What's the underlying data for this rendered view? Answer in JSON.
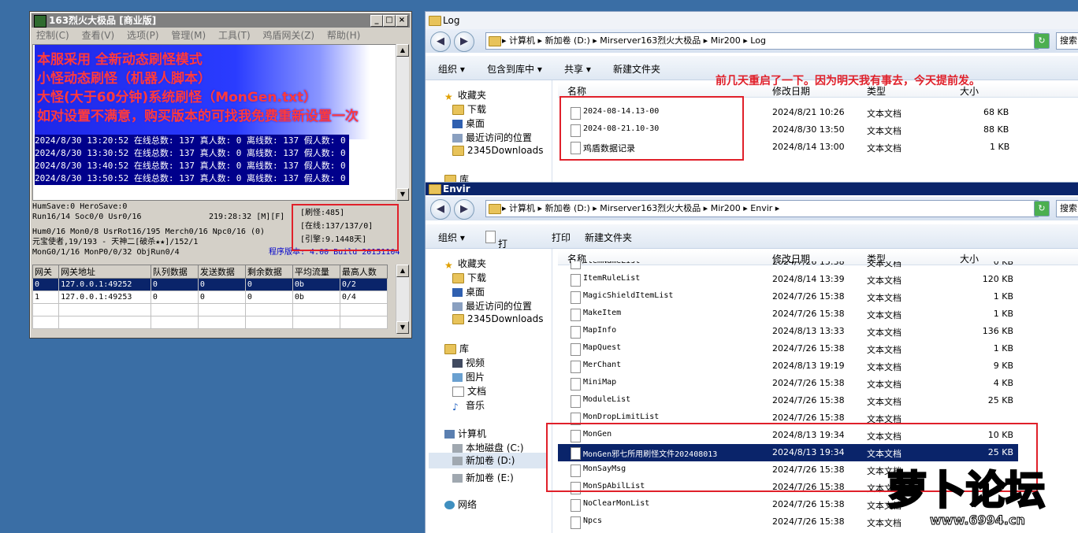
{
  "server": {
    "title": "163烈火大极品 [商业版]",
    "menu": [
      "控制(C)",
      "查看(V)",
      "选项(P)",
      "管理(M)",
      "工具(T)",
      "鸡盾网关(Z)",
      "帮助(H)"
    ],
    "banner_lines": [
      "本服采用 全新动态刷怪模式",
      "小怪动态刷怪（机器人脚本）",
      "大怪(大于60分钟)系统刷怪（MonGen.txt）",
      "如对设置不满意，购买版本的可找我免费重新设置一次"
    ],
    "log_lines": [
      "2024/8/30 13:20:52 在线总数: 137 真人数: 0 离线数: 137 假人数: 0",
      "2024/8/30 13:30:52 在线总数: 137 真人数: 0 离线数: 137 假人数: 0",
      "2024/8/30 13:40:52 在线总数: 137 真人数: 0 离线数: 137 假人数: 0",
      "2024/8/30 13:50:52 在线总数: 137 真人数: 0 离线数: 137 假人数: 0"
    ],
    "status": {
      "line1": "HumSave:0 HeroSave:0",
      "line2": "Run16/14 Soc0/0 Usr0/16",
      "clock": "219:28:32 [M][F]",
      "line3": "Hum0/16 Mon0/8 UsrRot16/195 Merch0/16 Npc0/16 (0)",
      "line4": "元宝使者,19/193 - 天神二[破杀★★]/152/1",
      "line5": "MonG0/1/16 MonP0/0/32 ObjRun0/4",
      "version": "程序版本: 4.00 Build 20151104",
      "box": [
        "[刷怪:485]",
        "[在线:137/137/0]",
        "[引擎:9.1448天]"
      ]
    },
    "gateway_table": {
      "headers": [
        "网关",
        "网关地址",
        "队列数据",
        "发送数据",
        "剩余数据",
        "平均流量",
        "最高人数"
      ],
      "rows": [
        [
          "0",
          "127.0.0.1:49252",
          "0",
          "0",
          "0",
          "0b",
          "0/2"
        ],
        [
          "1",
          "127.0.0.1:49253",
          "0",
          "0",
          "0",
          "0b",
          "0/4"
        ]
      ]
    }
  },
  "log_window": {
    "title": "Log",
    "address": "▸ 计算机 ▸ 新加卷 (D:) ▸ Mirserver163烈火大极品 ▸ Mir200 ▸ Log",
    "search": "搜索",
    "commands": [
      "组织 ▾",
      "包含到库中 ▾",
      "共享 ▾",
      "新建文件夹"
    ],
    "nav": [
      "收藏夹",
      "下载",
      "桌面",
      "最近访问的位置",
      "2345Downloads",
      "库"
    ],
    "columns": [
      "名称",
      "修改日期",
      "类型",
      "大小"
    ],
    "files": [
      {
        "name": "2024-08-14.13-00",
        "date": "2024/8/21 10:26",
        "type": "文本文档",
        "size": "68 KB"
      },
      {
        "name": "2024-08-21.10-30",
        "date": "2024/8/30 13:50",
        "type": "文本文档",
        "size": "88 KB"
      },
      {
        "name": "鸡盾数据记录",
        "date": "2024/8/14 13:00",
        "type": "文本文档",
        "size": "1 KB"
      }
    ],
    "notice": "前几天重启了一下。因为明天我有事去，今天提前发。"
  },
  "envir_window": {
    "title": "Envir",
    "address": "▸ 计算机 ▸ 新加卷 (D:) ▸ Mirserver163烈火大极品 ▸ Mir200 ▸ Envir ▸",
    "search": "搜索",
    "commands": [
      "组织 ▾",
      "打开 ▾",
      "打印",
      "新建文件夹"
    ],
    "nav": [
      "收藏夹",
      "下载",
      "桌面",
      "最近访问的位置",
      "2345Downloads",
      "库",
      "视频",
      "图片",
      "文档",
      "音乐",
      "计算机",
      "本地磁盘 (C:)",
      "新加卷 (D:)",
      "新加卷 (E:)",
      "网络"
    ],
    "columns": [
      "名称",
      "修改日期",
      "类型",
      "大小"
    ],
    "files": [
      {
        "name": "ItemNameList",
        "date": "2024/7/26 15:38",
        "type": "文本文档",
        "size": "0 KB"
      },
      {
        "name": "ItemRuleList",
        "date": "2024/8/14 13:39",
        "type": "文本文档",
        "size": "120 KB"
      },
      {
        "name": "MagicShieldItemList",
        "date": "2024/7/26 15:38",
        "type": "文本文档",
        "size": "1 KB"
      },
      {
        "name": "MakeItem",
        "date": "2024/7/26 15:38",
        "type": "文本文档",
        "size": "1 KB"
      },
      {
        "name": "MapInfo",
        "date": "2024/8/13 13:33",
        "type": "文本文档",
        "size": "136 KB"
      },
      {
        "name": "MapQuest",
        "date": "2024/7/26 15:38",
        "type": "文本文档",
        "size": "1 KB"
      },
      {
        "name": "MerChant",
        "date": "2024/8/13 19:19",
        "type": "文本文档",
        "size": "9 KB"
      },
      {
        "name": "MiniMap",
        "date": "2024/7/26 15:38",
        "type": "文本文档",
        "size": "4 KB"
      },
      {
        "name": "ModuleList",
        "date": "2024/7/26 15:38",
        "type": "文本文档",
        "size": "25 KB"
      },
      {
        "name": "MonDropLimitList",
        "date": "2024/7/26 15:38",
        "type": "文本文档",
        "size": ""
      },
      {
        "name": "MonGen",
        "date": "2024/8/13 19:34",
        "type": "文本文档",
        "size": "10 KB"
      },
      {
        "name": "MonGen邪七所用刷怪文件202408013",
        "date": "2024/8/13 19:34",
        "type": "文本文档",
        "size": "25 KB"
      },
      {
        "name": "MonSayMsg",
        "date": "2024/7/26 15:38",
        "type": "文本文档",
        "size": ""
      },
      {
        "name": "MonSpAbilList",
        "date": "2024/7/26 15:38",
        "type": "文本文档",
        "size": ""
      },
      {
        "name": "NoClearMonList",
        "date": "2024/7/26 15:38",
        "type": "文本文档",
        "size": ""
      },
      {
        "name": "Npcs",
        "date": "2024/7/26 15:38",
        "type": "文本文档",
        "size": ""
      }
    ],
    "selected_index": 11
  },
  "watermark": {
    "text": "萝卜论坛",
    "url": "www.6994.cn"
  },
  "colors": {
    "desktop": "#3a6ea5",
    "highlight_red": "#e0202a",
    "selection": "#0a246a",
    "banner_red": "#ff3b3b"
  }
}
